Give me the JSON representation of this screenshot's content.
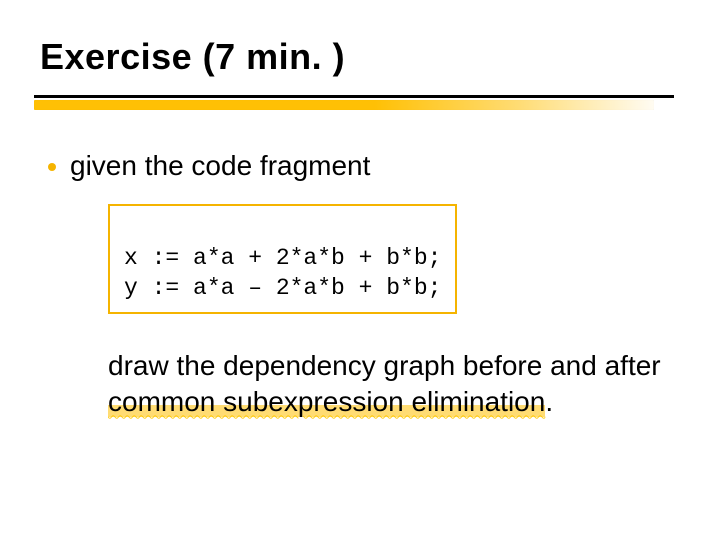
{
  "title": "Exercise (7 min. )",
  "bullet": {
    "lead": "given the code fragment"
  },
  "code": {
    "line1": "x := a*a + 2*a*b + b*b;",
    "line2": "y := a*a – 2*a*b + b*b;"
  },
  "after": {
    "prefix": "draw the dependency graph before and after ",
    "highlight": "common subexpression elimination",
    "suffix": "."
  }
}
